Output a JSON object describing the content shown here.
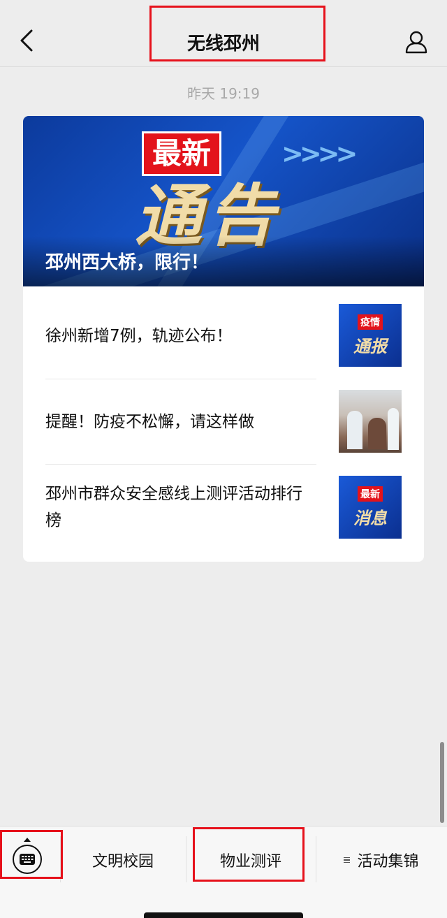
{
  "header": {
    "title": "无线邳州"
  },
  "timestamp": "昨天 19:19",
  "article_card": {
    "hero": {
      "badge_text": "最新",
      "big_text": "通告",
      "title": "邳州西大桥，限行！"
    },
    "items": [
      {
        "title": "徐州新增7例，轨迹公布！",
        "thumb": {
          "type": "blue",
          "line1": "疫情",
          "line2": "通报"
        }
      },
      {
        "title": "提醒！防疫不松懈，请这样做",
        "thumb": {
          "type": "photo"
        }
      },
      {
        "title": "邳州市群众安全感线上测评活动排行榜",
        "thumb": {
          "type": "blue",
          "line1": "最新",
          "line2": "消息"
        }
      }
    ]
  },
  "bottom_menu": {
    "items": [
      {
        "label": "文明校园"
      },
      {
        "label": "物业测评"
      },
      {
        "label": "活动集锦"
      }
    ]
  },
  "colors": {
    "highlight": "#e6111b",
    "background": "#ededed",
    "card": "#ffffff"
  }
}
